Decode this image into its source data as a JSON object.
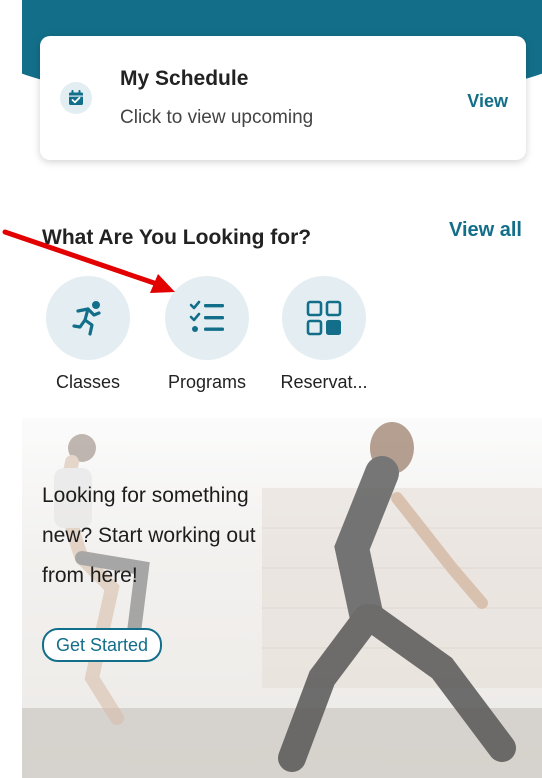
{
  "schedule": {
    "title": "My Schedule",
    "subtitle": "Click to view upcoming",
    "view_label": "View",
    "icon": "calendar-check-icon"
  },
  "section": {
    "title": "What Are You Looking for?",
    "view_all_label": "View all"
  },
  "categories": [
    {
      "label": "Classes",
      "icon": "running-icon"
    },
    {
      "label": "Programs",
      "icon": "checklist-icon"
    },
    {
      "label": "Reservat...",
      "icon": "grid-icon"
    }
  ],
  "hero": {
    "line1": "Looking for something",
    "line2": "new? Start working out",
    "line3": "from here!",
    "button_label": "Get Started"
  },
  "colors": {
    "brand_teal": "#136f89",
    "icon_bg": "#e4eef2",
    "annotation_red": "#e30000"
  }
}
